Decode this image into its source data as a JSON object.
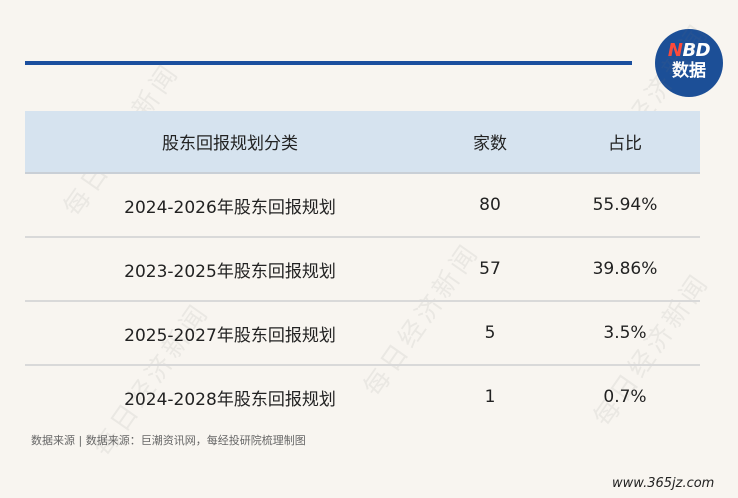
{
  "logo": {
    "line1_n": "N",
    "line1_rest": "BD",
    "line2": "数据"
  },
  "table": {
    "headers": [
      "股东回报规划分类",
      "家数",
      "占比"
    ],
    "rows": [
      [
        "2024-2026年股东回报规划",
        "80",
        "55.94%"
      ],
      [
        "2023-2025年股东回报规划",
        "57",
        "39.86%"
      ],
      [
        "2025-2027年股东回报规划",
        "5",
        "3.5%"
      ],
      [
        "2024-2028年股东回报规划",
        "1",
        "0.7%"
      ]
    ]
  },
  "source": "数据来源 | 数据来源：巨潮资讯网，每经投研院梳理制图",
  "watermark": "每日经济新闻",
  "site": "www.365jz.com",
  "colors": {
    "accent": "#1b4f9e",
    "header_bg": "#d6e3ef",
    "page_bg": "#f8f5f0"
  }
}
